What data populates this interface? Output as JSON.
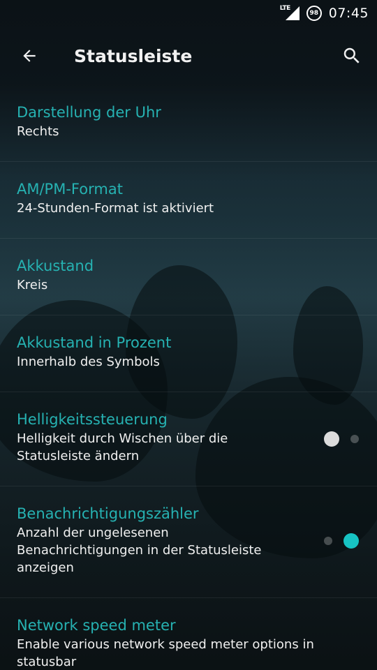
{
  "status_bar": {
    "network": "LTE",
    "battery": "98",
    "time": "07:45"
  },
  "toolbar": {
    "title": "Statusleiste"
  },
  "colors": {
    "accent": "#26b2b2",
    "switch_on": "#17c3c3",
    "text_primary": "#f0f0f0"
  },
  "settings": [
    {
      "title": "Darstellung der Uhr",
      "summary": "Rechts"
    },
    {
      "title": "AM/PM-Format",
      "summary": "24-Stunden-Format ist aktiviert"
    },
    {
      "title": "Akkustand",
      "summary": "Kreis"
    },
    {
      "title": "Akkustand in Prozent",
      "summary": "Innerhalb des Symbols"
    },
    {
      "title": "Helligkeitssteuerung",
      "summary": "Helligkeit durch Wischen über die Statusleiste ändern",
      "switch_on": false
    },
    {
      "title": "Benachrichtigungszähler",
      "summary": "Anzahl der ungelesenen Benachrichtigungen in der Statusleiste anzeigen",
      "switch_on": true
    },
    {
      "title": "Network speed meter",
      "summary": "Enable various network speed meter options in statusbar"
    }
  ]
}
